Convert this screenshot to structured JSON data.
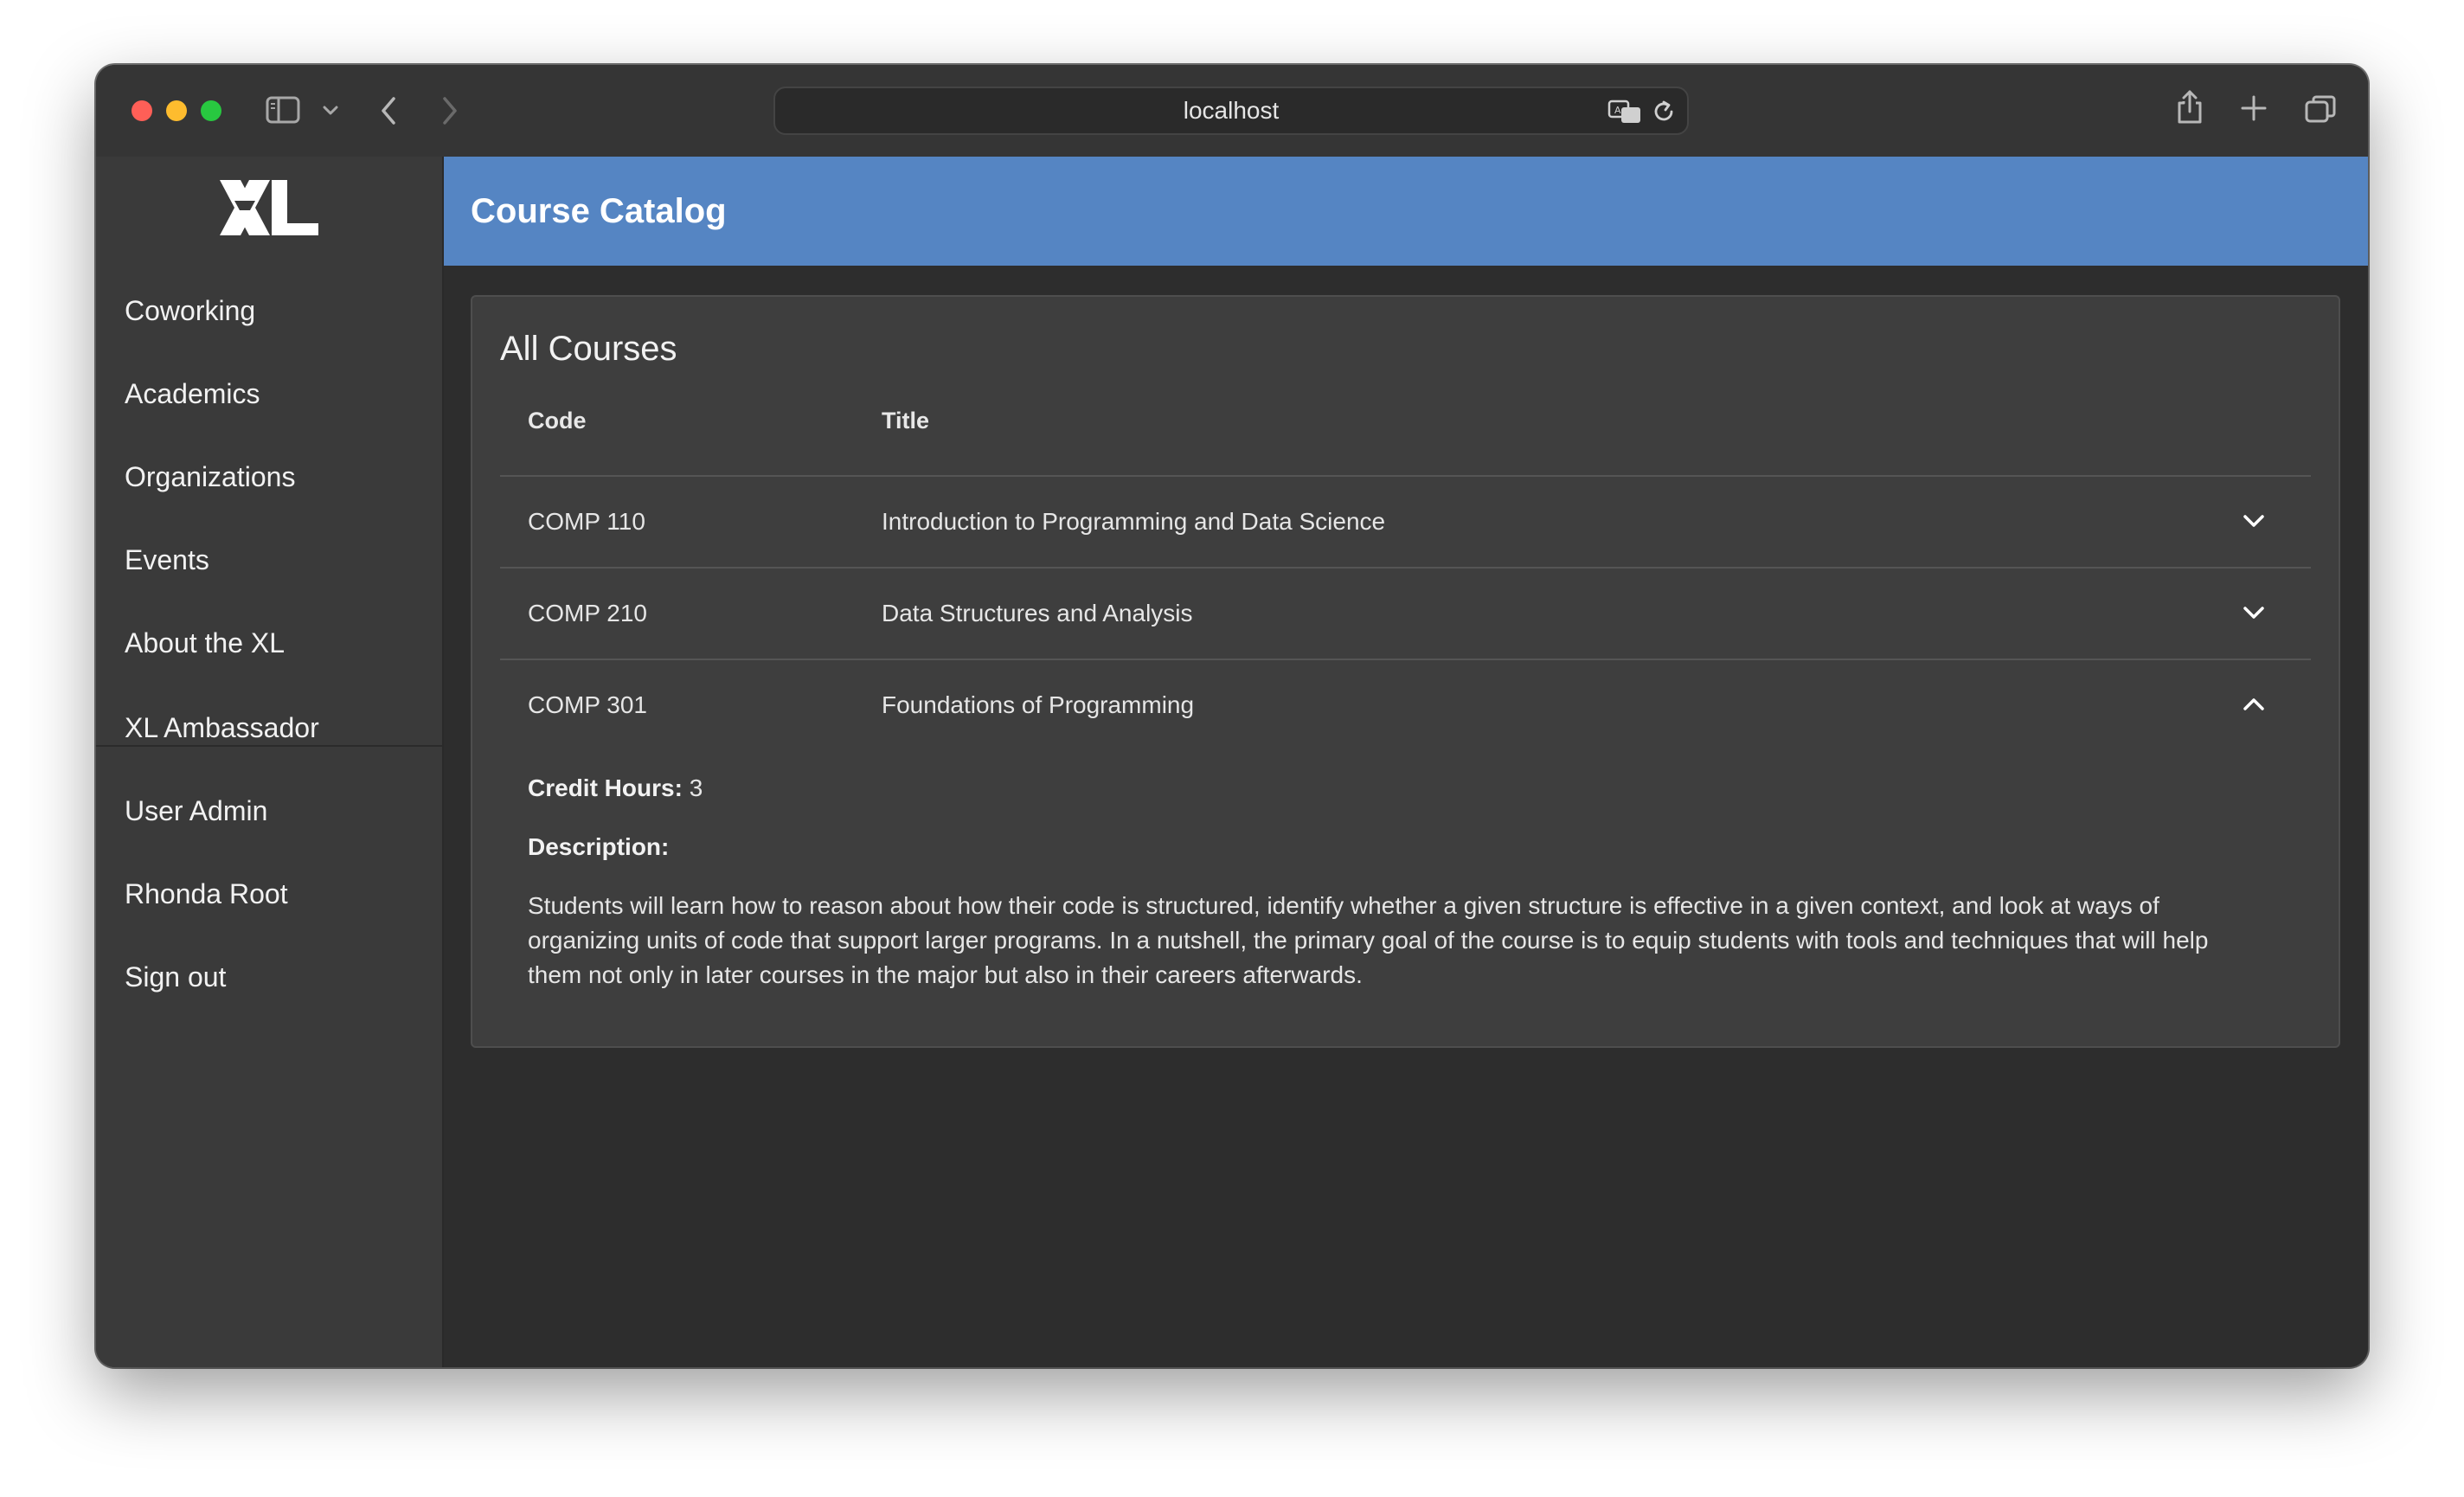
{
  "browser": {
    "url": "localhost",
    "icons": [
      "sidebar-toggle-icon",
      "chevron-down-icon",
      "back-icon",
      "forward-icon",
      "translate-icon",
      "reload-icon",
      "share-icon",
      "new-tab-icon",
      "tabs-overview-icon"
    ]
  },
  "sidebar": {
    "logo_text": "XL",
    "items": [
      {
        "label": "Coworking"
      },
      {
        "label": "Academics"
      },
      {
        "label": "Organizations"
      },
      {
        "label": "Events"
      },
      {
        "label": "About the XL"
      },
      {
        "label": "XL Ambassador"
      },
      {
        "label": "User Admin"
      },
      {
        "label": "Rhonda Root"
      },
      {
        "label": "Sign out"
      }
    ]
  },
  "header": {
    "title": "Course Catalog"
  },
  "catalog": {
    "heading": "All Courses",
    "columns": [
      "Code",
      "Title"
    ],
    "rows": [
      {
        "code": "COMP 110",
        "title": "Introduction to Programming and Data Science",
        "expanded": false
      },
      {
        "code": "COMP 210",
        "title": "Data Structures and Analysis",
        "expanded": false
      },
      {
        "code": "COMP 301",
        "title": "Foundations of Programming",
        "expanded": true
      }
    ],
    "detail": {
      "credit_label": "Credit Hours:",
      "credit_value": "3",
      "description_label": "Description:",
      "description": "Students will learn how to reason about how their code is structured, identify whether a given structure is effective in a given context, and look at ways of organizing units of code that support larger programs. In a nutshell, the primary goal of the course is to equip students with tools and techniques that will help them not only in later courses in the major but also in their careers afterwards."
    }
  },
  "colors": {
    "header_bg": "#5585c3",
    "sidebar_bg": "#3a3a3a",
    "card_bg": "#3e3e3e",
    "page_bg": "#2d2d2d"
  }
}
